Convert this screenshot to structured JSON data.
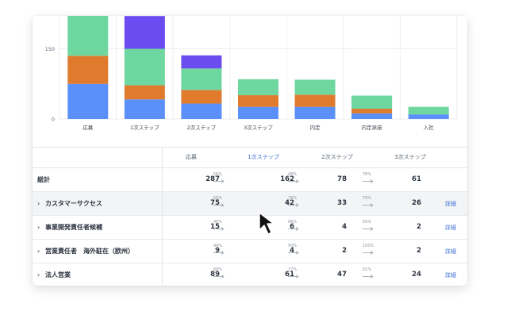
{
  "chart_data": {
    "type": "bar",
    "stacked": true,
    "categories": [
      "応募",
      "1次ステップ",
      "2次ステップ",
      "3次ステップ",
      "内定",
      "内定承諾",
      "入社"
    ],
    "series": [
      {
        "color": "#5b8ff9",
        "values": [
          75,
          42,
          33,
          26,
          26,
          12,
          10
        ]
      },
      {
        "color": "#e07b2e",
        "values": [
          60,
          30,
          29,
          25,
          26,
          10,
          0
        ]
      },
      {
        "color": "#6ed7a0",
        "values": [
          110,
          78,
          46,
          34,
          32,
          28,
          16
        ]
      },
      {
        "color": "#6a4cf0",
        "values": [
          0,
          70,
          28,
          0,
          0,
          0,
          0
        ]
      }
    ],
    "yticks": [
      0,
      150
    ],
    "ylim": [
      0,
      180
    ],
    "grid": true
  },
  "table": {
    "headers": [
      "応募",
      "1次ステップ",
      "2次ステップ",
      "3次ステップ"
    ],
    "detail_label": "詳細",
    "total": {
      "label": "総計",
      "values": [
        "287",
        "162",
        "78",
        "61"
      ],
      "rates": [
        "56%",
        "48%",
        "78%"
      ]
    },
    "rows": [
      {
        "label": "カスタマーサクセス",
        "values": [
          "75",
          "42",
          "33",
          "26"
        ],
        "rates": [
          "56%",
          "78%",
          "79%"
        ]
      },
      {
        "label": "事業開発責任者候補",
        "values": [
          "15",
          "6",
          "4",
          "2"
        ],
        "rates": [
          "46%",
          "66%",
          "50%"
        ]
      },
      {
        "label": "営業責任者　海外駐在（欧州）",
        "values": [
          "9",
          "4",
          "2",
          "2"
        ],
        "rates": [
          "44%",
          "50%",
          "100%"
        ]
      },
      {
        "label": "法人営業",
        "values": [
          "89",
          "61",
          "47",
          "24"
        ],
        "rates": [
          "68%",
          "77%",
          "51%"
        ]
      }
    ]
  }
}
